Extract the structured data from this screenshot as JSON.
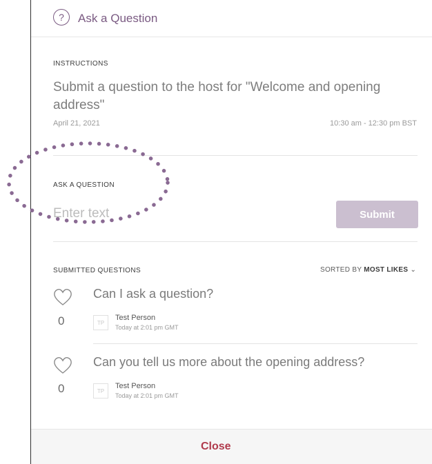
{
  "header": {
    "title": "Ask a Question",
    "icon": "question-circle-icon"
  },
  "instructions": {
    "label": "INSTRUCTIONS",
    "text": "Submit a question to the host for \"Welcome and opening address\"",
    "date": "April 21, 2021",
    "time": "10:30 am - 12:30 pm BST"
  },
  "ask": {
    "label": "ASK A QUESTION",
    "placeholder": "Enter text",
    "submit_label": "Submit"
  },
  "submitted": {
    "label": "SUBMITTED QUESTIONS",
    "sorted_prefix": "SORTED BY",
    "sorted_value": "MOST LIKES",
    "questions": [
      {
        "text": "Can I ask a question?",
        "likes": "0",
        "initials": "TP",
        "author": "Test Person",
        "time": "Today at 2:01 pm GMT"
      },
      {
        "text": "Can you tell us more about the opening address?",
        "likes": "0",
        "initials": "TP",
        "author": "Test Person",
        "time": "Today at 2:01 pm GMT"
      }
    ]
  },
  "footer": {
    "close_label": "Close"
  },
  "colors": {
    "accent": "#7a5a82",
    "submit_bg": "#cbbfd0",
    "close": "#b03a4c",
    "annotation": "#8a6a93"
  }
}
